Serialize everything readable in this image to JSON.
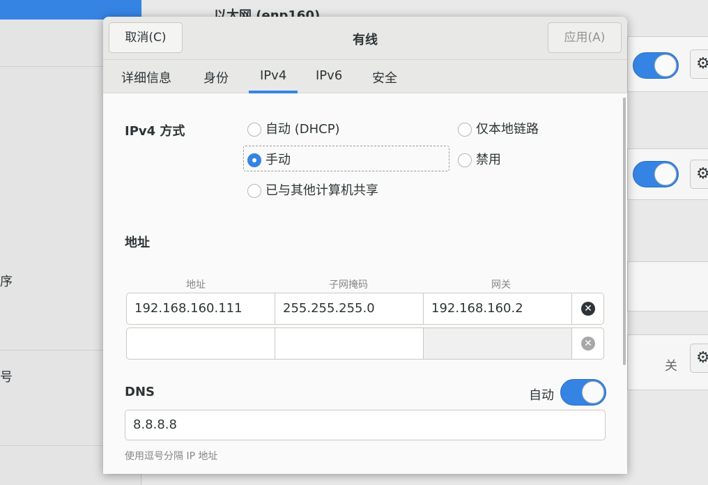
{
  "background": {
    "heading": "以太网 (enp160)",
    "sidebar_rows": [
      "序",
      "号"
    ],
    "off_label": "关"
  },
  "dialog": {
    "title": "有线",
    "cancel_label": "取消(C)",
    "apply_label": "应用(A)",
    "tabs": [
      {
        "label": "详细信息",
        "active": false
      },
      {
        "label": "身份",
        "active": false
      },
      {
        "label": "IPv4",
        "active": true
      },
      {
        "label": "IPv6",
        "active": false
      },
      {
        "label": "安全",
        "active": false
      }
    ],
    "ipv4_method": {
      "label": "IPv4 方式",
      "options": [
        {
          "label": "自动 (DHCP)",
          "checked": false
        },
        {
          "label": "仅本地链路",
          "checked": false
        },
        {
          "label": "手动",
          "checked": true
        },
        {
          "label": "禁用",
          "checked": false
        },
        {
          "label": "已与其他计算机共享",
          "checked": false
        }
      ]
    },
    "addresses": {
      "label": "地址",
      "columns": [
        "地址",
        "子网掩码",
        "网关"
      ],
      "rows": [
        [
          "192.168.160.111",
          "255.255.255.0",
          "192.168.160.2"
        ],
        [
          "",
          "",
          ""
        ]
      ]
    },
    "dns": {
      "label": "DNS",
      "auto_label": "自动",
      "auto_enabled": true,
      "value": "8.8.8.8",
      "hint": "使用逗号分隔 IP 地址"
    }
  },
  "colors": {
    "accent": "#3584e4",
    "header_bg": "#e8e8e7",
    "dialog_bg": "#fafafa"
  }
}
